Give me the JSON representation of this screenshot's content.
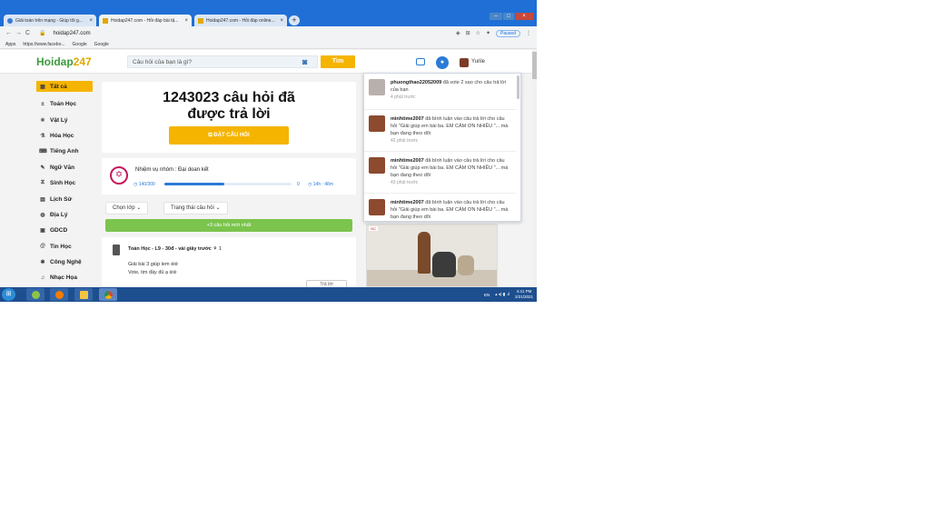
{
  "browser": {
    "tabs": [
      {
        "label": "Giải toán trên mạng - Giúp tôi g..."
      },
      {
        "label": "Hoidap247.com - Hỏi đáp bài tậ..."
      },
      {
        "label": "Hoidap247.com - Hỏi đáp online..."
      }
    ],
    "close_glyph": "×",
    "new_tab_glyph": "+",
    "url": "hoidap247.com",
    "profile_status": "Paused",
    "bookmarks": [
      "Apps",
      "https://www.facebo...",
      "Google",
      "Google"
    ]
  },
  "site": {
    "logo_text": "Hoidap",
    "logo_num": "247",
    "search_placeholder": "Câu hỏi của bạn là gì?",
    "search_button": "Tìm",
    "user_name": "Yurile"
  },
  "sidebar": {
    "items": [
      {
        "label": "Tất cả",
        "icon": "grid-icon"
      },
      {
        "label": "Toán Học",
        "icon": "math-icon"
      },
      {
        "label": "Vật Lý",
        "icon": "atom-icon"
      },
      {
        "label": "Hóa Học",
        "icon": "flask-icon"
      },
      {
        "label": "Tiếng Anh",
        "icon": "keyboard-icon"
      },
      {
        "label": "Ngữ Văn",
        "icon": "pen-icon"
      },
      {
        "label": "Sinh Học",
        "icon": "dna-icon"
      },
      {
        "label": "Lịch Sử",
        "icon": "book-icon"
      },
      {
        "label": "Địa Lý",
        "icon": "globe-icon"
      },
      {
        "label": "GDCD",
        "icon": "people-icon"
      },
      {
        "label": "Tin Học",
        "icon": "at-icon"
      },
      {
        "label": "Công Nghệ",
        "icon": "gear-icon"
      },
      {
        "label": "Nhạc Họa",
        "icon": "music-icon"
      }
    ]
  },
  "hero": {
    "title_line1": "1243023 câu hỏi đã",
    "title_line2": "được trả lời",
    "ask_button": "ĐẶT CÂU HỎI"
  },
  "mission": {
    "title": "Nhiệm vụ nhóm : Đại doan kết",
    "count": "140/300",
    "progress": 0.47,
    "zero": "0",
    "time": "14h : 48m"
  },
  "filters": {
    "class_label": "Chọn lớp",
    "status_label": "Trạng thái câu hỏi"
  },
  "new_questions": "+3 câu hỏi mới nhất",
  "question": {
    "subject": "Toán Học",
    "meta": " - L9 - 30đ - vài giây trước",
    "count": "1",
    "line1": "Giải bài 3 giúp lem ᪤᪤",
    "line2": "Vote, tim đầy đủ ạ ᪤᪤",
    "reply": "Trả lời"
  },
  "notifications": [
    {
      "user": "phuongthao22052009",
      "text": " đã vote 2 sao cho câu trả lời của bạn",
      "time": "4 phút trước"
    },
    {
      "user": "minhtime2007",
      "text": " đã bình luận vào câu trả lời cho câu hỏi \"Giải giúp em bài ba. EM CẢM ƠN NHIỀU \"... mà bạn đang theo dõi",
      "time": "42 phút trước"
    },
    {
      "user": "minhtime2007",
      "text": " đã bình luận vào câu trả lời cho câu hỏi \"Giải giúp em bài ba. EM CẢM ƠN NHIỀU \"... mà bạn đang theo dõi",
      "time": "43 phút trước"
    },
    {
      "user": "minhtime2007",
      "text": " đã bình luận vào câu trả lời cho câu hỏi \"Giải giúp em bài ba. EM CẢM ƠN NHIỀU \"... mà bạn đang theo dõi",
      "time": ""
    }
  ],
  "taskbar": {
    "lang": "EN",
    "time": "4:41 PM",
    "date": "2/21/2021"
  }
}
